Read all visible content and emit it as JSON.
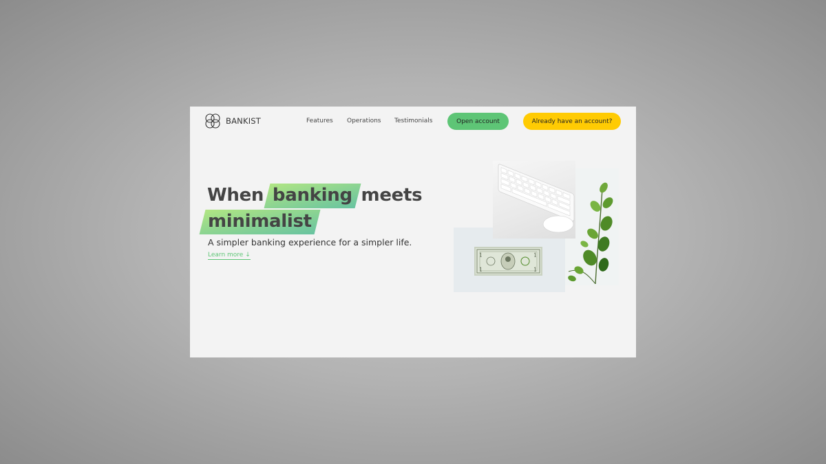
{
  "brand": {
    "name": "BANKIST",
    "logo_icon": "clover-logo-icon"
  },
  "nav": {
    "links": [
      "Features",
      "Operations",
      "Testimonials"
    ],
    "open_account": "Open account",
    "login": "Already have an account?"
  },
  "hero": {
    "line1_pre": "When ",
    "line1_highlight": "banking",
    "line1_post": " meets",
    "line2_highlight": "minimalist",
    "subtitle": "A simpler banking experience for a simpler life.",
    "learn_more": "Learn more ↓"
  },
  "colors": {
    "primary": "#5ec576",
    "secondary": "#ffcb03",
    "background": "#f3f3f3"
  }
}
